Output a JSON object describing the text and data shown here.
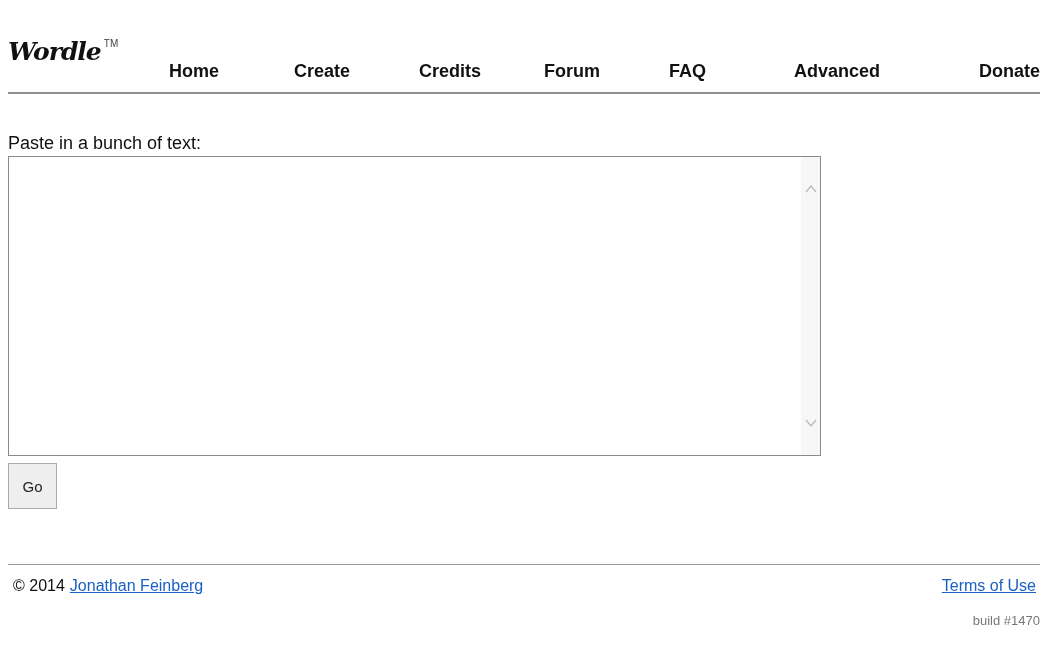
{
  "logo": {
    "text": "Wordle",
    "mark": "TM"
  },
  "nav": [
    "Home",
    "Create",
    "Credits",
    "Forum",
    "FAQ",
    "Advanced",
    "Donate"
  ],
  "form": {
    "label": "Paste in a bunch of text:",
    "button": "Go"
  },
  "footer": {
    "copyright": "© 2014",
    "author": "Jonathan Feinberg",
    "terms": "Terms of Use",
    "build": "build #1470"
  }
}
